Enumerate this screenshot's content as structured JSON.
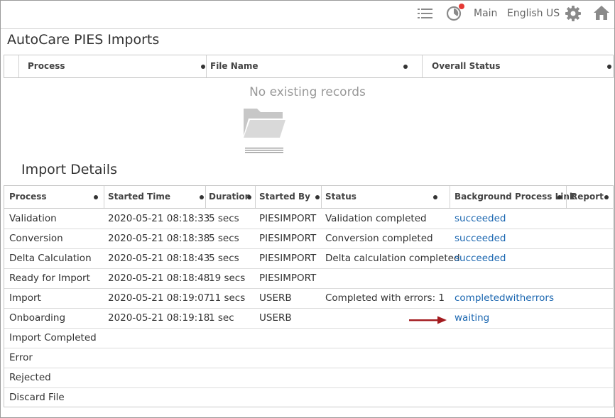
{
  "topbar": {
    "main_label": "Main",
    "language_label": "English US"
  },
  "imports": {
    "title": "AutoCare PIES Imports",
    "columns": [
      "Process",
      "File Name",
      "Overall Status"
    ],
    "empty_message": "No existing records"
  },
  "details": {
    "title": "Import Details",
    "columns": [
      "Process",
      "Started Time",
      "Duration",
      "Started By",
      "Status",
      "Background Process Link",
      "Report"
    ],
    "rows": [
      {
        "process": "Validation",
        "started": "2020-05-21 08:18:33",
        "duration": "5 secs",
        "by": "PIESIMPORT",
        "status": "Validation completed",
        "link": "succeeded"
      },
      {
        "process": "Conversion",
        "started": "2020-05-21 08:18:38",
        "duration": "5 secs",
        "by": "PIESIMPORT",
        "status": "Conversion completed",
        "link": "succeeded"
      },
      {
        "process": "Delta Calculation",
        "started": "2020-05-21 08:18:43",
        "duration": "5 secs",
        "by": "PIESIMPORT",
        "status": "Delta calculation completed",
        "link": "succeeded"
      },
      {
        "process": "Ready for Import",
        "started": "2020-05-21 08:18:48",
        "duration": "19 secs",
        "by": "PIESIMPORT",
        "status": "",
        "link": ""
      },
      {
        "process": "Import",
        "started": "2020-05-21 08:19:07",
        "duration": "11 secs",
        "by": "USERB",
        "status": "Completed with errors: 1",
        "link": "completedwitherrors"
      },
      {
        "process": "Onboarding",
        "started": "2020-05-21 08:19:18",
        "duration": "1 sec",
        "by": "USERB",
        "status": "",
        "link": "waiting"
      },
      {
        "process": "Import Completed",
        "started": "",
        "duration": "",
        "by": "",
        "status": "",
        "link": ""
      },
      {
        "process": "Error",
        "started": "",
        "duration": "",
        "by": "",
        "status": "",
        "link": ""
      },
      {
        "process": "Rejected",
        "started": "",
        "duration": "",
        "by": "",
        "status": "",
        "link": ""
      },
      {
        "process": "Discard File",
        "started": "",
        "duration": "",
        "by": "",
        "status": "",
        "link": ""
      }
    ]
  },
  "colors": {
    "link": "#1a66b0",
    "annotation_arrow": "#a31b1f",
    "notification_dot": "#e53935"
  }
}
